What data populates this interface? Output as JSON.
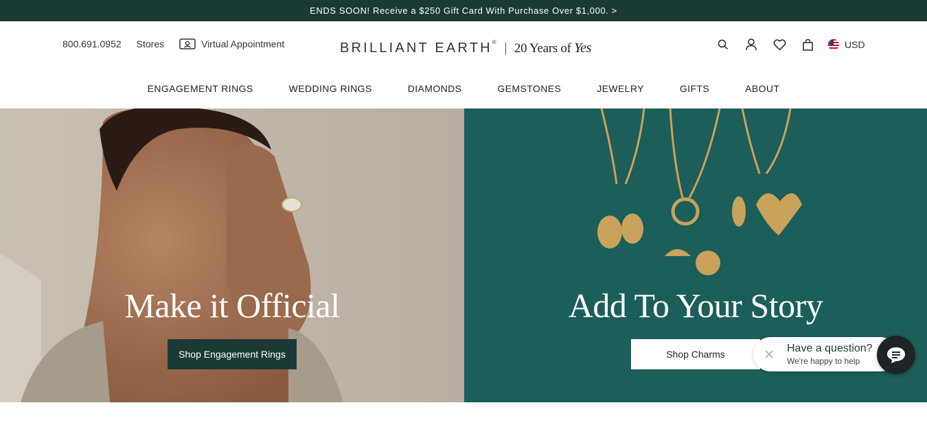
{
  "promo": {
    "text": "ENDS SOON! Receive a $250 Gift Card With Purchase Over $1,000. >"
  },
  "header": {
    "phone": "800.691.0952",
    "stores": "Stores",
    "virtual_appointment": "Virtual Appointment",
    "logo_brand": "BRILLIANT EARTH",
    "logo_reg": "®",
    "logo_tag_prefix": "20 Years of ",
    "logo_tag_yes": "Yes",
    "currency": "USD",
    "icons": [
      "search-icon",
      "account-icon",
      "wishlist-icon",
      "bag-icon",
      "us-flag-icon"
    ]
  },
  "nav": {
    "items": [
      "ENGAGEMENT RINGS",
      "WEDDING RINGS",
      "DIAMONDS",
      "GEMSTONES",
      "JEWELRY",
      "GIFTS",
      "ABOUT"
    ]
  },
  "hero_left": {
    "title": "Make it Official",
    "cta": "Shop Engagement Rings",
    "bg_color": "#bdb3a6"
  },
  "hero_right": {
    "title": "Add To Your Story",
    "cta": "Shop Charms",
    "bg_color": "#1b5f5a"
  },
  "chat": {
    "question": "Have a question?",
    "subtext": "We're happy to help"
  },
  "colors": {
    "brand_dark": "#1b3a36",
    "teal": "#1b5f5a"
  }
}
